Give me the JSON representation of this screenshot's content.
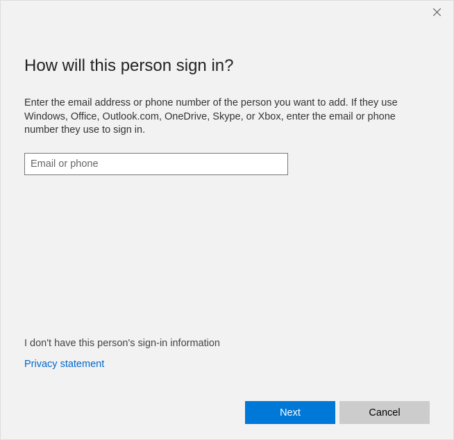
{
  "heading": "How will this person sign in?",
  "description": "Enter the email address or phone number of the person you want to add. If they use Windows, Office, Outlook.com, OneDrive, Skype, or Xbox, enter the email or phone number they use to sign in.",
  "input": {
    "placeholder": "Email or phone",
    "value": ""
  },
  "links": {
    "no_info": "I don't have this person's sign-in information",
    "privacy": "Privacy statement"
  },
  "buttons": {
    "next": "Next",
    "cancel": "Cancel"
  }
}
